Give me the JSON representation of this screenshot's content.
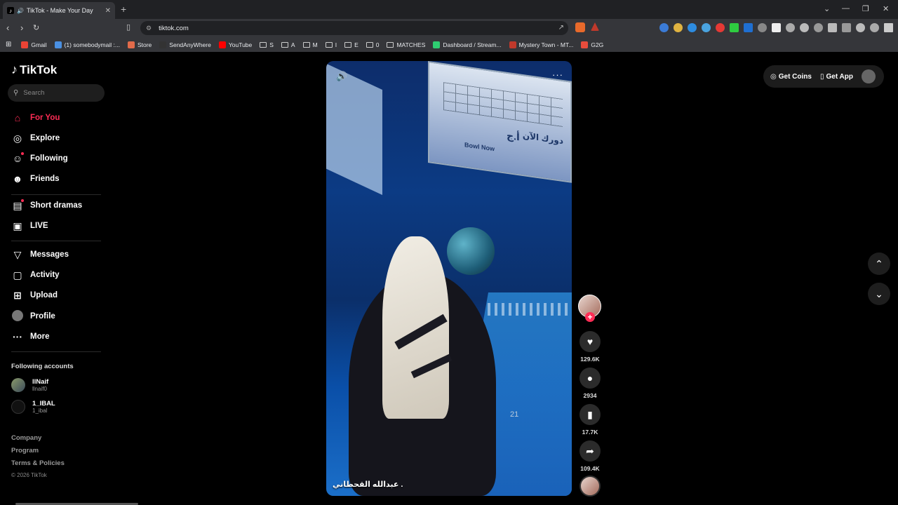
{
  "browser": {
    "tab_title": "TikTok - Make Your Day",
    "url": "tiktok.com",
    "bookmarks": [
      {
        "label": "Gmail",
        "color": "#ea4335"
      },
      {
        "label": "(1) somebodymail :...",
        "color": "#4a90e2"
      },
      {
        "label": "Store",
        "color": "#e26b4a"
      },
      {
        "label": "SendAnyWhere",
        "color": "#333333"
      },
      {
        "label": "YouTube",
        "color": "#ff0000"
      },
      {
        "label": "S",
        "folder": true
      },
      {
        "label": "A",
        "folder": true
      },
      {
        "label": "M",
        "folder": true
      },
      {
        "label": "I",
        "folder": true
      },
      {
        "label": "E",
        "folder": true
      },
      {
        "label": "0",
        "folder": true
      },
      {
        "label": "MATCHES",
        "folder": true
      },
      {
        "label": "Dashboard / Stream...",
        "color": "#2ecc71"
      },
      {
        "label": "Mystery Town - MT...",
        "color": "#c0392b"
      },
      {
        "label": "G2G",
        "color": "#e74c3c"
      }
    ]
  },
  "tiktok": {
    "logo": "TikTok",
    "search_placeholder": "Search",
    "nav": [
      {
        "label": "For You",
        "icon": "home-icon"
      },
      {
        "label": "Explore",
        "icon": "compass-icon"
      },
      {
        "label": "Following",
        "icon": "following-icon"
      },
      {
        "label": "Friends",
        "icon": "friends-icon"
      },
      {
        "label": "Short dramas",
        "icon": "film-icon"
      },
      {
        "label": "LIVE",
        "icon": "tv-icon"
      },
      {
        "label": "Messages",
        "icon": "send-icon"
      },
      {
        "label": "Activity",
        "icon": "message-box-icon"
      },
      {
        "label": "Upload",
        "icon": "plus-box-icon"
      },
      {
        "label": "Profile",
        "icon": "avatar-icon"
      },
      {
        "label": "More",
        "icon": "ellipsis-icon"
      }
    ],
    "following_label": "Following accounts",
    "accounts": [
      {
        "name": "llNaif",
        "handle": "llnaif0"
      },
      {
        "name": "1_IBAL",
        "handle": "1_ibal"
      }
    ],
    "footer": {
      "company": "Company",
      "program": "Program",
      "terms": "Terms & Policies",
      "copyright": "© 2026 TikTok"
    },
    "topright": {
      "coins": "Get Coins",
      "app": "Get App"
    },
    "video": {
      "caption": "عبدالله القحطاني .",
      "board_arabic": "دورك الآن",
      "board_english": "Bowl Now",
      "board_initials": "أ.ج",
      "lane_number": "21"
    },
    "actions": {
      "likes": "129.6K",
      "comments": "2934",
      "saves": "17.7K",
      "shares": "109.4K"
    }
  },
  "colors": {
    "accent": "#fe2c55"
  }
}
